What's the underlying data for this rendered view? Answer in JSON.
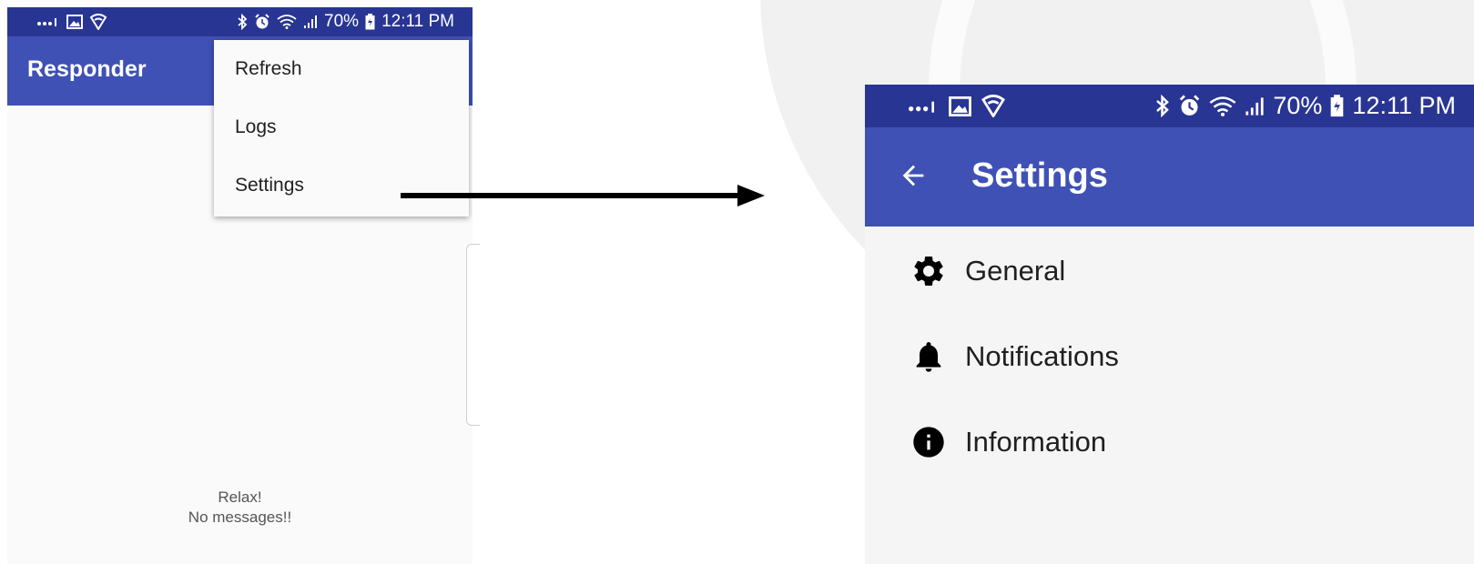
{
  "left_screen": {
    "status": {
      "left_icons": [
        "signal-dots-icon",
        "image-icon",
        "shield-wifi-icon"
      ],
      "right_icons": [
        "bluetooth-icon",
        "alarm-icon",
        "wifi-icon",
        "signal-icon"
      ],
      "battery": "70%",
      "time": "12:11 PM"
    },
    "app_title": "Responder",
    "menu": {
      "items": [
        {
          "label": "Refresh"
        },
        {
          "label": "Logs"
        },
        {
          "label": "Settings"
        }
      ]
    },
    "empty_state": {
      "line1": "Relax!",
      "line2": "No messages!!"
    }
  },
  "right_screen": {
    "status": {
      "left_icons": [
        "signal-dots-icon",
        "image-icon",
        "shield-wifi-icon"
      ],
      "right_icons": [
        "bluetooth-icon",
        "alarm-icon",
        "wifi-icon",
        "signal-icon"
      ],
      "battery": "70%",
      "time": "12:11 PM"
    },
    "title": "Settings",
    "items": [
      {
        "label": "General",
        "icon": "gear-icon"
      },
      {
        "label": "Notifications",
        "icon": "bell-icon"
      },
      {
        "label": "Information",
        "icon": "info-icon"
      }
    ]
  },
  "colors": {
    "status_bar": "#283593",
    "app_bar": "#3f51b5",
    "background": "#fafafa"
  }
}
